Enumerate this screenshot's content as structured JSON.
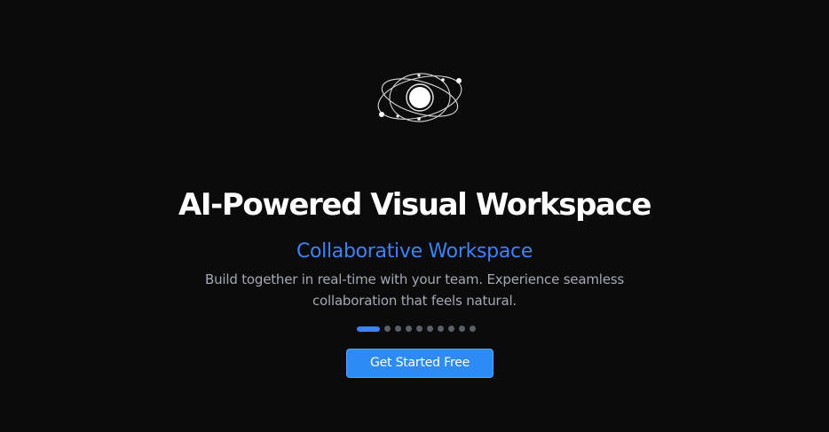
{
  "logo": {
    "icon": "orbit-atom-icon"
  },
  "hero": {
    "title": "AI-Powered Visual Workspace",
    "subtitle": "Collaborative Workspace",
    "description": "Build together in real-time with your team. Experience seamless collaboration that feels natural."
  },
  "carousel": {
    "active_index": 1,
    "total_slides": 10
  },
  "cta": {
    "label": "Get Started Free"
  },
  "colors": {
    "background": "#0b0b0c",
    "accent": "#3f82f6",
    "button": "#2d8bf6",
    "text_muted": "#a3a8b3",
    "dot_inactive": "#5b5f68"
  }
}
